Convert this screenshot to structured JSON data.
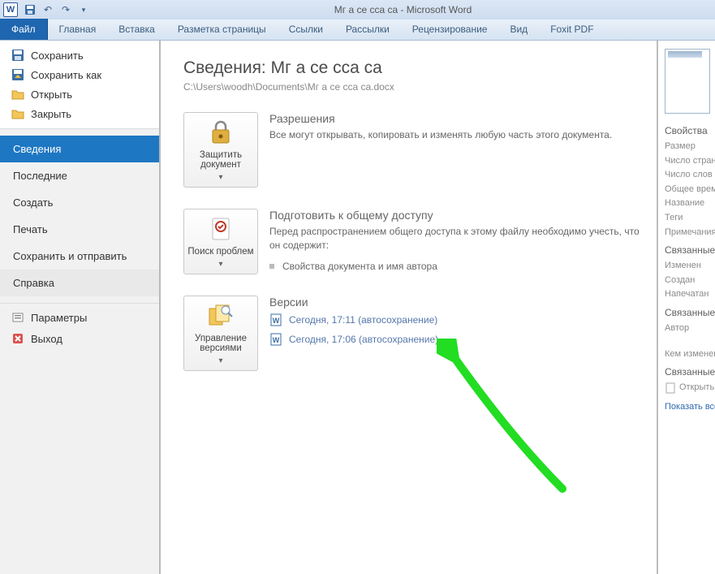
{
  "titlebar": {
    "title": "Мг а се  сса са  -  Microsoft Word"
  },
  "ribbon": {
    "file": "Файл",
    "tabs": [
      "Главная",
      "Вставка",
      "Разметка страницы",
      "Ссылки",
      "Рассылки",
      "Рецензирование",
      "Вид",
      "Foxit PDF"
    ]
  },
  "sidebar": {
    "top": [
      {
        "label": "Сохранить",
        "icon": "save"
      },
      {
        "label": "Сохранить как",
        "icon": "save-as"
      },
      {
        "label": "Открыть",
        "icon": "open"
      },
      {
        "label": "Закрыть",
        "icon": "close"
      }
    ],
    "nav": [
      "Сведения",
      "Последние",
      "Создать",
      "Печать",
      "Сохранить и отправить",
      "Справка"
    ],
    "nav_active_index": 0,
    "bottom": [
      {
        "label": "Параметры",
        "icon": "options"
      },
      {
        "label": "Выход",
        "icon": "exit"
      }
    ]
  },
  "info": {
    "heading_prefix": "Сведения: ",
    "heading_doc": "Мг а се  сса са",
    "path": "C:\\Users\\woodh\\Documents\\Мг а се  сса са.docx",
    "permissions": {
      "button": "Защитить документ",
      "title": "Разрешения",
      "desc": "Все могут открывать, копировать и изменять любую часть этого документа."
    },
    "prepare": {
      "button": "Поиск проблем",
      "title": "Подготовить к общему доступу",
      "desc": "Перед распространением общего доступа к этому файлу необходимо учесть, что он содержит:",
      "bullet": "Свойства документа и имя автора"
    },
    "versions": {
      "button": "Управление версиями",
      "title": "Версии",
      "items": [
        "Сегодня, 17:11 (автосохранение)",
        "Сегодня, 17:06 (автосохранение)"
      ]
    }
  },
  "right": {
    "heading": "Свойства",
    "rows": [
      "Размер",
      "Число страниц",
      "Число слов",
      "Общее время",
      "Название",
      "Теги",
      "Примечания"
    ],
    "related_dates_h": "Связанные даты",
    "related_dates": [
      "Изменен",
      "Создан",
      "Напечатан"
    ],
    "related_people_h": "Связанные люди",
    "related_people": [
      "Автор",
      "Кем изменен"
    ],
    "related_docs_h": "Связанные документы",
    "related_doc": "Открыть",
    "show_all": "Показать все"
  }
}
